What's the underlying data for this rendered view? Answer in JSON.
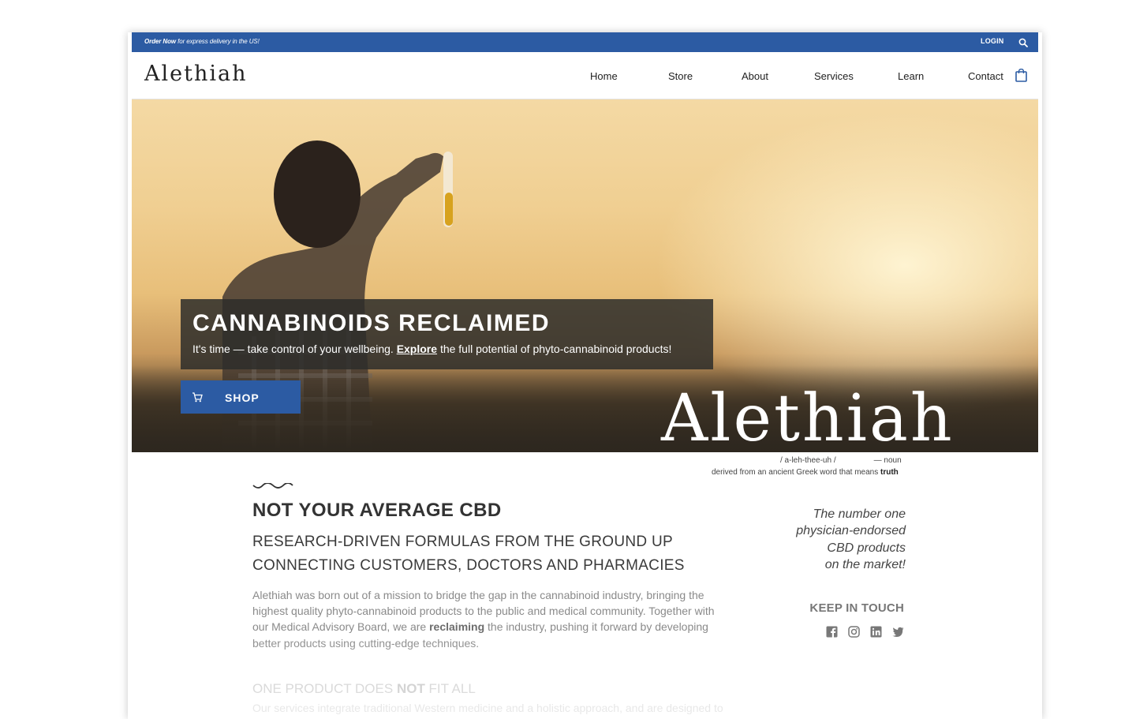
{
  "topbar": {
    "promo_bold": "Order Now",
    "promo_rest": " for express delivery in the US!",
    "login_label": "LOGIN",
    "search_icon": "search-icon"
  },
  "header": {
    "logo": "Alethiah",
    "nav": {
      "home": "Home",
      "store": "Store",
      "about": "About",
      "services": "Services",
      "learn": "Learn",
      "contact": "Contact"
    },
    "cart_icon": "shopping-bag-icon"
  },
  "hero": {
    "title": "CANNABINOIDS RECLAIMED",
    "sub_prefix": "It's time — take control of your wellbeing.",
    "sub_link": "Explore",
    "sub_suffix": "the full potential of phyto-cannabinoid products!",
    "shop_label": "SHOP",
    "big_word": "Alethiah",
    "pronunciation": "/ a-leh-thee-uh /",
    "part_of_speech": "— noun",
    "derivation_prefix": "derived from an ancient Greek word that means ",
    "derivation_bold": "truth"
  },
  "content": {
    "heading": "NOT YOUR AVERAGE CBD",
    "subheading1": "RESEARCH-DRIVEN FORMULAS FROM THE GROUND UP",
    "subheading2": "CONNECTING CUSTOMERS, DOCTORS AND PHARMACIES",
    "para_part1": "Alethiah was born out of a mission to bridge the gap in the cannabinoid industry, bringing the highest quality phyto-cannabinoid products to the public and medical community. Together with our Medical Advisory Board, we are ",
    "para_bold": "reclaiming",
    "para_part2": " the industry, pushing it forward by developing better products using cutting-edge techniques.",
    "section2_heading_prefix": "ONE PRODUCT DOES ",
    "section2_heading_bold": "NOT",
    "section2_heading_suffix": " FIT ALL",
    "section2_text": "Our services integrate traditional Western medicine and a holistic approach, and are designed to"
  },
  "sidebar": {
    "tagline_1": "The number one",
    "tagline_2": "physician-endorsed",
    "tagline_3": "CBD products",
    "tagline_4": "on the market!",
    "keep_in_touch": "KEEP IN TOUCH",
    "social_icons": [
      "facebook-icon",
      "instagram-icon",
      "linkedin-icon",
      "twitter-icon"
    ]
  },
  "colors": {
    "brand_blue": "#2c5ba3",
    "banner_bg": "#2d2d2a",
    "text_dark": "#333333",
    "text_muted": "#8a8a8a"
  }
}
